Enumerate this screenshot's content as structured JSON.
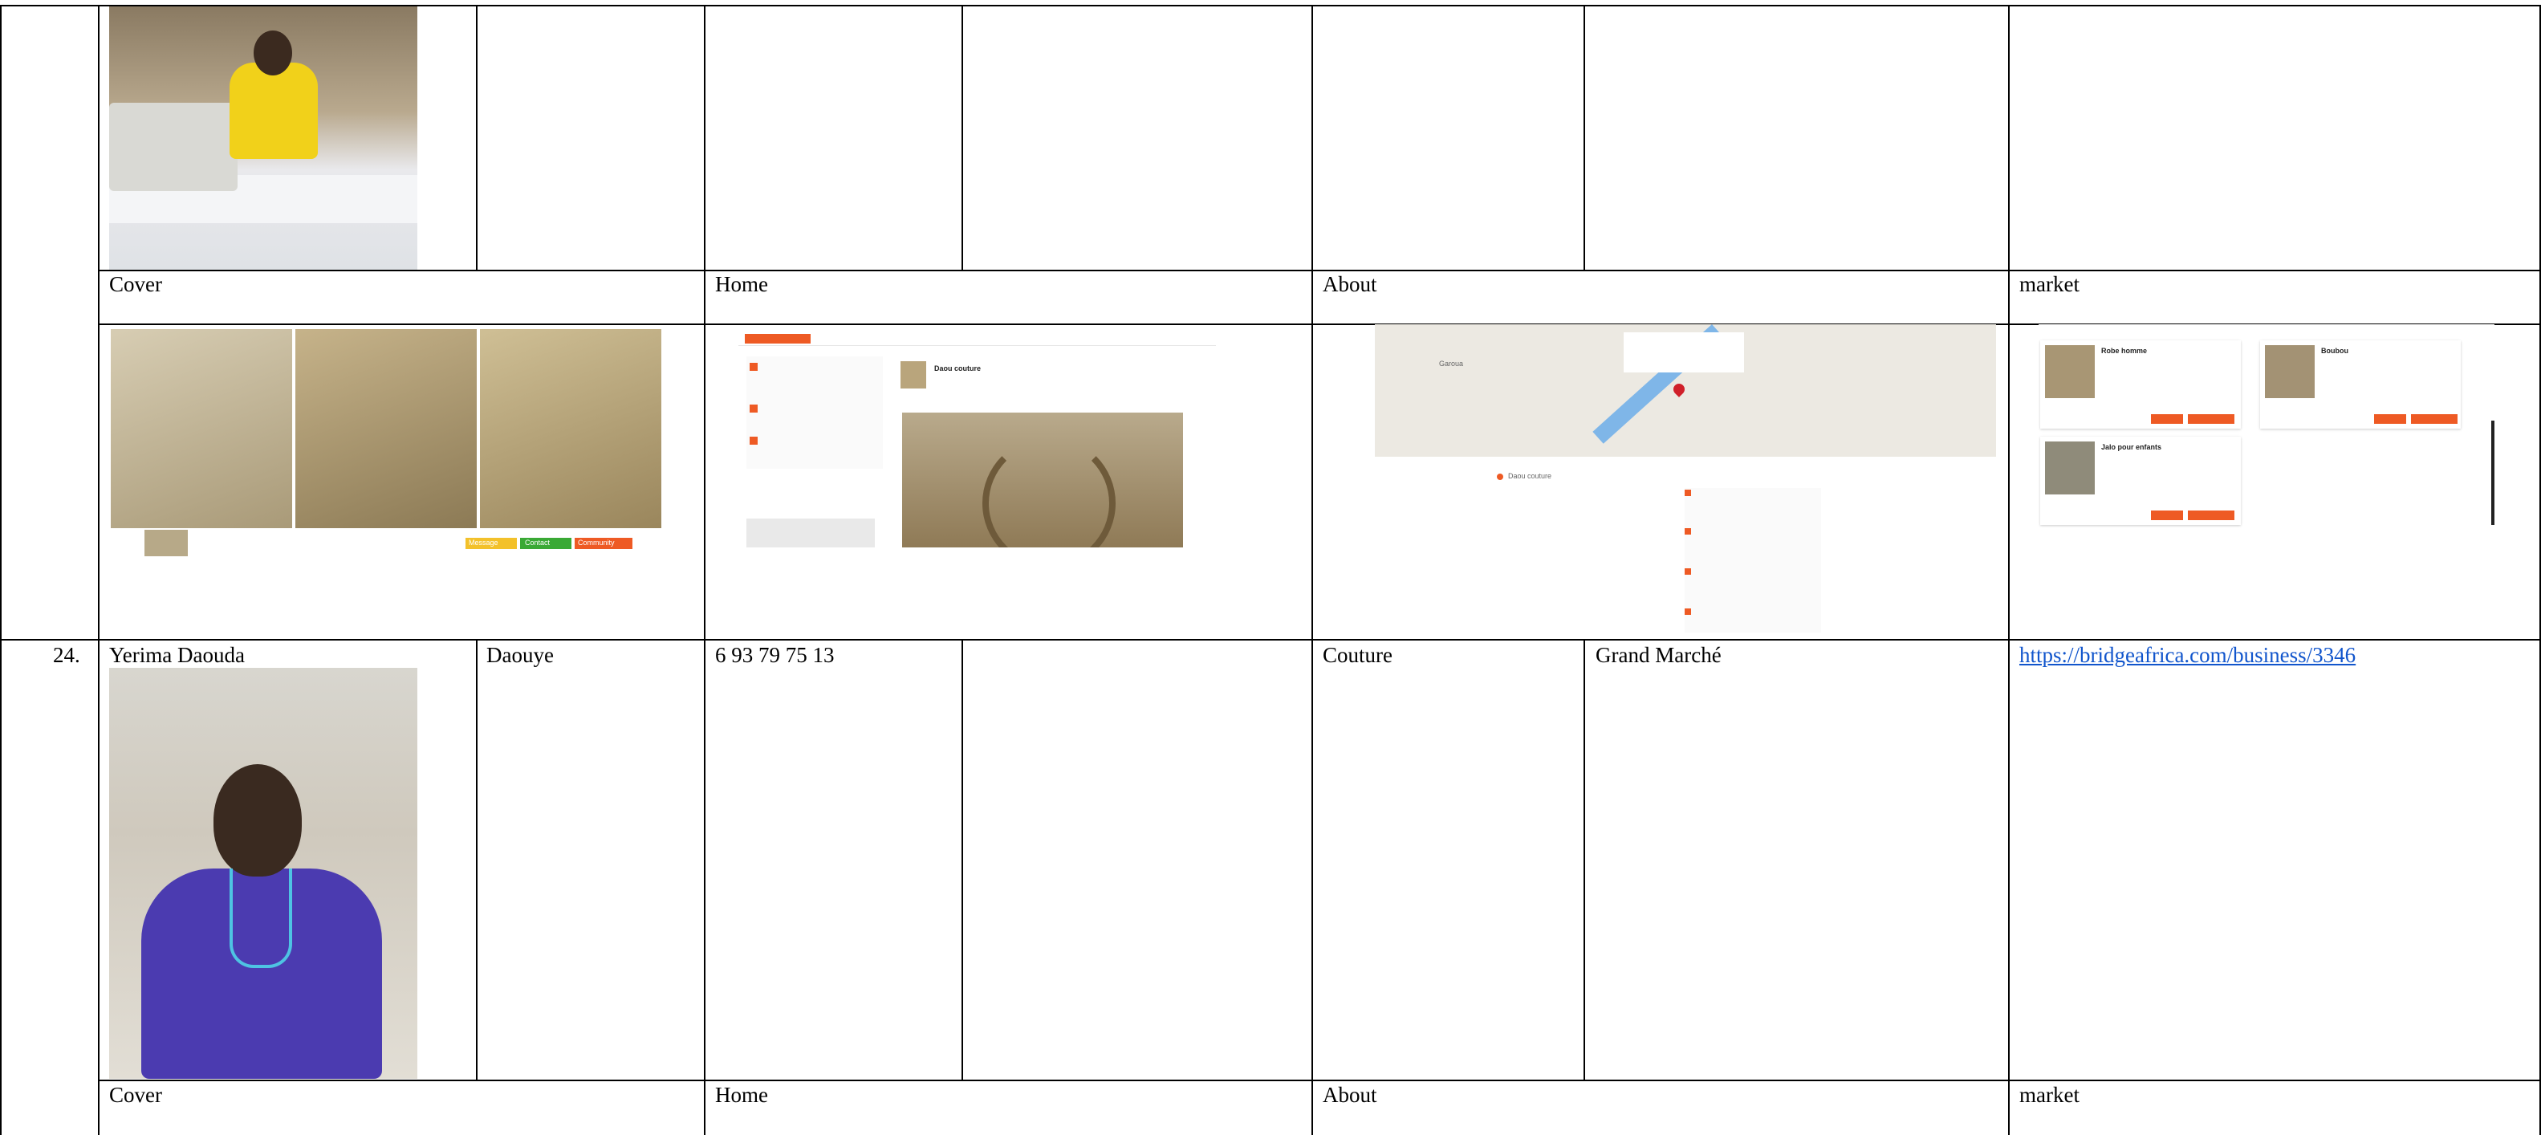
{
  "row_prev": {
    "labels": {
      "cover": "Cover",
      "home": "Home",
      "about": "About",
      "market": "market"
    }
  },
  "row_24": {
    "number": "24.",
    "name": "Yerima Daouda",
    "alias": "Daouye",
    "phone": "6 93 79 75 13",
    "category": "Couture",
    "location": "Grand Marché",
    "url": "https://bridgeafrica.com/business/3346",
    "labels": {
      "cover": "Cover",
      "home": "Home",
      "about": "About",
      "market": "market"
    }
  },
  "screenshots": {
    "home_business_name": "Daou couture",
    "about_map_city": "Garoua",
    "about_business_label": "Daou couture",
    "market_items": [
      "Robe homme",
      "Boubou",
      "Jalo pour enfants"
    ],
    "cover_buttons": [
      "Message",
      "Contact",
      "Community"
    ]
  },
  "colors": {
    "accent": "#ee5a24",
    "link": "#1155cc",
    "grid": "#000000"
  }
}
